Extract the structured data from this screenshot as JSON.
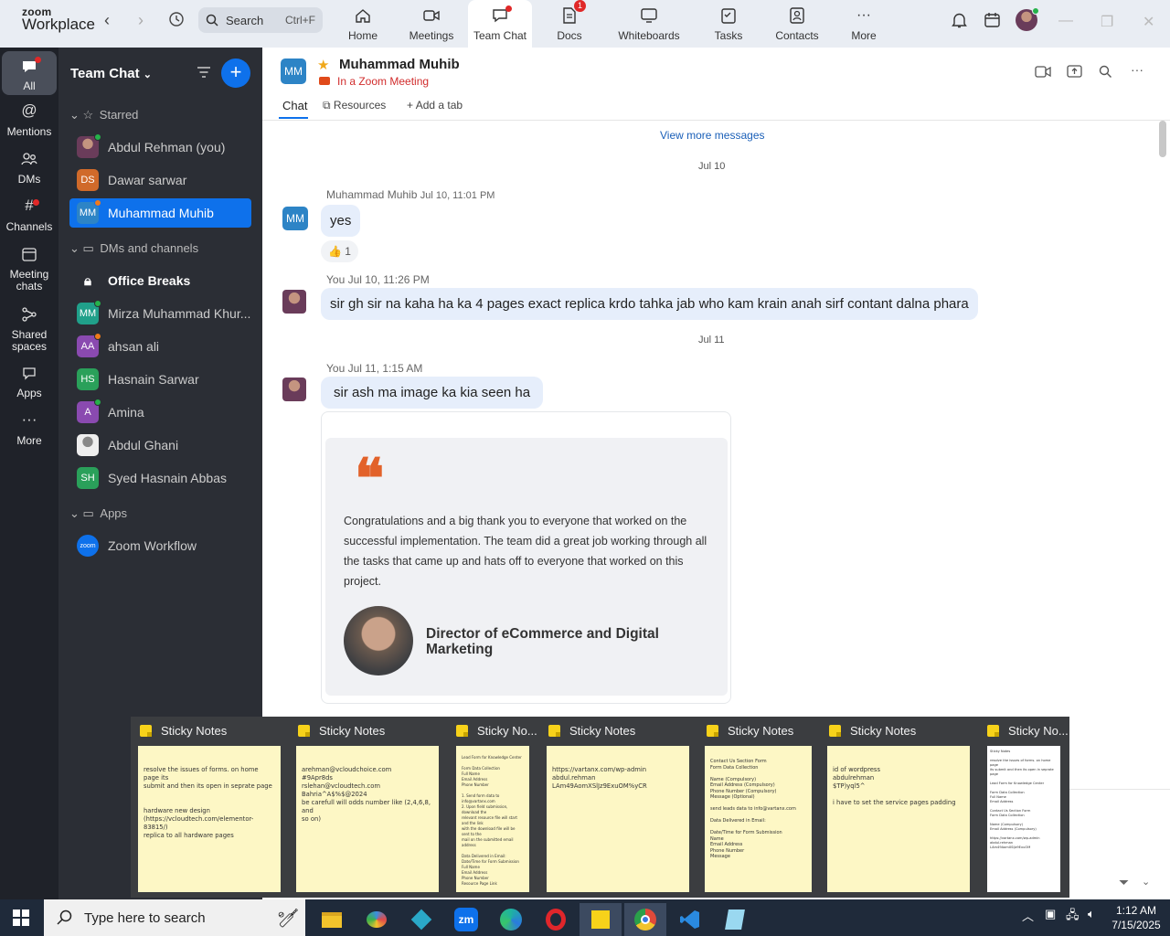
{
  "app": {
    "logo_small": "zoom",
    "logo_big": "Workplace"
  },
  "search": {
    "label": "Search",
    "shortcut": "Ctrl+F"
  },
  "nav": [
    {
      "label": "Home",
      "icon": "home-icon"
    },
    {
      "label": "Meetings",
      "icon": "video-icon"
    },
    {
      "label": "Team Chat",
      "icon": "chat-icon",
      "active": true
    },
    {
      "label": "Docs",
      "icon": "docs-icon",
      "badge": "1"
    },
    {
      "label": "Whiteboards",
      "icon": "whiteboard-icon"
    },
    {
      "label": "Tasks",
      "icon": "tasks-icon"
    },
    {
      "label": "Contacts",
      "icon": "contacts-icon"
    },
    {
      "label": "More",
      "icon": "more-icon"
    }
  ],
  "rail": [
    {
      "label": "All",
      "icon": "chat-bubble-icon"
    },
    {
      "label": "Mentions",
      "icon": "at-icon"
    },
    {
      "label": "DMs",
      "icon": "people-icon"
    },
    {
      "label": "Channels",
      "icon": "hash-icon"
    },
    {
      "label": "Meeting chats",
      "icon": "calendar-icon"
    },
    {
      "label": "Shared spaces",
      "icon": "share-icon"
    },
    {
      "label": "Apps",
      "icon": "apps-icon"
    },
    {
      "label": "More",
      "icon": "ellipsis-icon"
    }
  ],
  "sidebar": {
    "title": "Team Chat",
    "starred_header": "Starred",
    "dms_header": "DMs and channels",
    "apps_header": "Apps",
    "starred": [
      {
        "initials": "",
        "name": "Abdul Rehman (you)",
        "color": "#7a4a6a"
      },
      {
        "initials": "DS",
        "name": "Dawar sarwar",
        "color": "#d06a2a"
      },
      {
        "initials": "MM",
        "name": "Muhammad Muhib",
        "color": "#2d84c6"
      }
    ],
    "dms": [
      {
        "initials": "",
        "name": "Office Breaks",
        "color": ""
      },
      {
        "initials": "MM",
        "name": "Mirza Muhammad Khur...",
        "color": "#20a08a"
      },
      {
        "initials": "AA",
        "name": "ahsan ali",
        "color": "#8a4ab0"
      },
      {
        "initials": "HS",
        "name": "Hasnain Sarwar",
        "color": "#2aa05a"
      },
      {
        "initials": "A",
        "name": "Amina",
        "color": "#8a4ab0"
      },
      {
        "initials": "",
        "name": "Abdul Ghani",
        "color": "#ddd"
      },
      {
        "initials": "SH",
        "name": "Syed Hasnain Abbas",
        "color": "#2aa05a"
      }
    ],
    "apps": [
      {
        "initials": "zoom",
        "name": "Zoom Workflow",
        "color": "#0e71eb"
      }
    ]
  },
  "chat": {
    "avatar": "MM",
    "name": "Muhammad Muhib",
    "status": "In a Zoom Meeting",
    "tabs": {
      "chat": "Chat",
      "resources": "Resources",
      "add": "Add a tab"
    },
    "view_more": "View more messages",
    "date1": "Jul 10",
    "date2": "Jul 11",
    "m1_sender": "Muhammad Muhib",
    "m1_time": "Jul 10, 11:01 PM",
    "m1_text": "yes",
    "m1_reaction": "👍 1",
    "m2_meta": "You Jul 10, 11:26 PM",
    "m2_text": "sir gh sir na kaha ha ka 4 pages exact replica krdo tahka jab who kam krain anah sirf contant dalna phara",
    "m3_meta": "You Jul 11, 1:15 AM",
    "m3_text": "sir ash ma image ka kia seen ha",
    "quote_text": "Congratulations and a big thank you to everyone that worked on the successful implementation. The team did a great job working through all the tasks that came up and hats off to everyone that worked on this project.",
    "quote_title": "Director of eCommerce and Digital Marketing"
  },
  "sticky_notes": [
    {
      "title": "Sticky Notes",
      "body": "resolve the issues of forms. on home page its\nsubmit and then its open in seprate page\n\n\nhardware new design\n(https://vcloudtech.com/elementor-83815/)\nreplica to all hardware pages"
    },
    {
      "title": "Sticky Notes",
      "body": "arehman@vcloudchoice.com\n#9Apr8ds\nrslehan@vcloudtech.com\nBahria^A$%$@2024\nbe carefull will odds number like (2,4,6,8, and\nso on)"
    },
    {
      "title": "Sticky No...",
      "body": "Lead Form for Knowledge Center\n\nForm Data Collection\nFull Name\nEmail Address\nPhone Number\n\n1. Send form data to info@vartanx.com\n2. Upon field submission, download the\nrelevant resource file will start and the link\nwith the download file will be sent to the\nmail on the submitted email address\n\nData Delivered in Email:\nDate/Time for Form Submission\nFull Name\nEmail Address\nPhone Number\nResource Page Link\n\nuse this tool:\nhttps://www.youtube.com/watch?v=\nsheets+integration+setup"
    },
    {
      "title": "Sticky Notes",
      "body": "https://vartanx.com/wp-admin\nabdul.rehman\nLAm49AomXSlJz9ExuOM%yCR"
    },
    {
      "title": "Sticky Notes",
      "body": "Contact Us Section Form\nForm Data Collection\n\nName (Compulsory)\nEmail Address (Compulsory)\nPhone Number (Compulsory)\nMessage (Optional)\n\nsend leads data to info@vartanx.com\n\nData Delivered in Email:\n\nDate/Time for Form Submission\nName\nEmail Address\nPhone Number\nMessage"
    },
    {
      "title": "Sticky Notes",
      "body": "id of wordpress\nabdulrehman\n$TP)yql5^\n\ni have to set the service pages padding"
    },
    {
      "title": "Sticky No...",
      "body": "Sticky Notes\n\nresolve the issues of forms. on home page\nits submit and then its open in seprate\npage\n\nLead Form for Knowledge Center\n\nForm Data Collection\nFull Name\nEmail Address\n\nContact Us Section Form\nForm Data Collection\n\nName (Compulsory)\nEmail Address (Compulsory)\n\nhttps://vartanx.com/wp-admin\nabdul.rehman\nLAm49AomXSlJz9ExuOM"
    }
  ],
  "taskbar": {
    "search_placeholder": "Type here to search",
    "time": "1:12 AM",
    "date": "7/15/2025"
  }
}
